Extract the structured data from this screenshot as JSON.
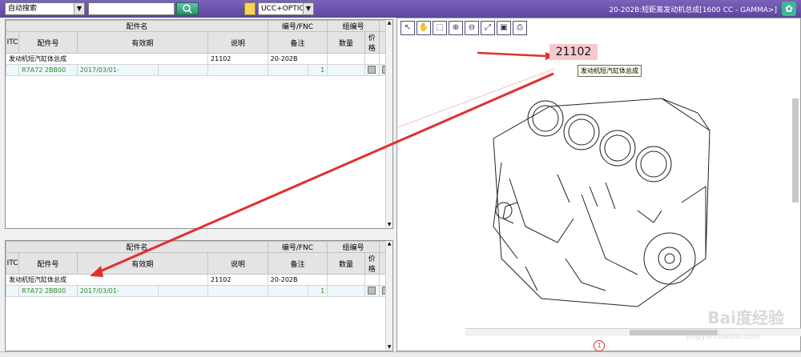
{
  "toolbar": {
    "search_mode": "自动搜索",
    "filter_option": "UCC+OPTION",
    "title": "20-202B:短距离发动机总成[1600 CC - GAMMA>]"
  },
  "table_headers": {
    "group_part_name": "配件名",
    "group_fnc": "编号/FNC",
    "group_code": "组编号",
    "itc": "ITC",
    "part_no": "配件号",
    "validity": "有效期",
    "description": "说明",
    "remark": "备注",
    "qty": "数量",
    "price": "价格"
  },
  "top_panel": {
    "rows": [
      {
        "name": "发动机短汽缸体总成",
        "fnc": "21102",
        "group": "20-202B"
      }
    ],
    "sub_rows": [
      {
        "part_no": "R7A72 2BB00",
        "validity": "2017/03/01-",
        "qty": "1"
      }
    ]
  },
  "bottom_panel": {
    "rows": [
      {
        "name": "发动机短汽缸体总成",
        "fnc": "21102",
        "group": "20-202B"
      }
    ],
    "sub_rows": [
      {
        "part_no": "R7A72 2BB00",
        "validity": "2017/03/01-",
        "qty": "1"
      }
    ]
  },
  "viewer": {
    "callout": "21102",
    "tooltip": "发动机短汽缸体总成",
    "page": "1",
    "tools": [
      "cursor-icon",
      "hand-icon",
      "zoom-box-icon",
      "zoom-in-icon",
      "zoom-out-icon",
      "fit-icon",
      "save-icon",
      "print-icon"
    ]
  },
  "colors": {
    "accent": "#6a53b0",
    "arrow": "#e0302e",
    "sub_row_text": "#2d8a2d"
  },
  "watermark": {
    "brand": "Bai度经验",
    "url": "jingyan.baidu.com"
  }
}
